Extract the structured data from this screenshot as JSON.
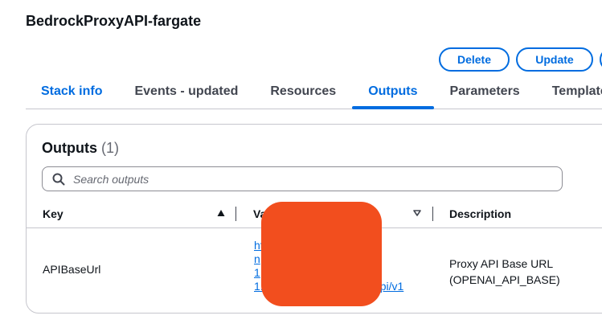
{
  "stack": {
    "title": "BedrockProxyAPI-fargate"
  },
  "actions": {
    "delete_label": "Delete",
    "update_label": "Update"
  },
  "tabs": [
    {
      "label": "Stack info"
    },
    {
      "label": "Events - updated"
    },
    {
      "label": "Resources"
    },
    {
      "label": "Outputs",
      "active": true
    },
    {
      "label": "Parameters"
    },
    {
      "label": "Template"
    }
  ],
  "outputs": {
    "title": "Outputs",
    "count": "(1)",
    "search_placeholder": "Search outputs",
    "columns": {
      "key": "Key",
      "value": "Value",
      "description": "Description"
    },
    "rows": [
      {
        "key": "APIBaseUrl",
        "value_lines": [
          "ht",
          "n",
          "1",
          "1.",
          "pi/v1"
        ],
        "description_lines": [
          "Proxy API Base URL",
          "(OPENAI_API_BASE)"
        ]
      }
    ]
  },
  "colors": {
    "accent": "#006ce0",
    "redaction": "#f24e1e",
    "border": "#c6c6cd"
  }
}
